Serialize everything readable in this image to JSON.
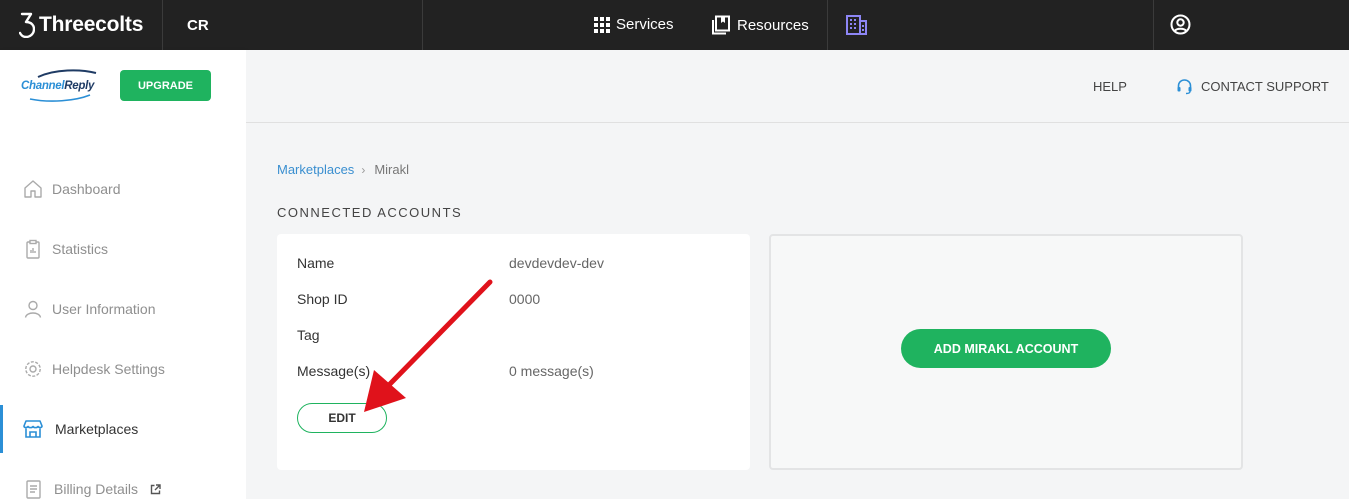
{
  "topbar": {
    "brand": "Threecolts",
    "account": "CR",
    "services_label": "Services",
    "resources_label": "Resources"
  },
  "sidebar": {
    "logo": {
      "part1": "Channel",
      "part2": "Reply"
    },
    "upgrade_label": "UPGRADE",
    "items": [
      {
        "label": "Dashboard",
        "icon": "home-icon"
      },
      {
        "label": "Statistics",
        "icon": "clipboard-icon"
      },
      {
        "label": "User Information",
        "icon": "user-icon"
      },
      {
        "label": "Helpdesk Settings",
        "icon": "gear-icon"
      },
      {
        "label": "Marketplaces",
        "icon": "store-icon",
        "active": true
      },
      {
        "label": "Billing Details",
        "icon": "document-icon",
        "external": true
      }
    ]
  },
  "header": {
    "help_label": "HELP",
    "support_label": "CONTACT SUPPORT"
  },
  "breadcrumb": {
    "parent": "Marketplaces",
    "current": "Mirakl"
  },
  "section_title": "CONNECTED ACCOUNTS",
  "account": {
    "fields": [
      {
        "label": "Name",
        "value": "devdevdev-dev"
      },
      {
        "label": "Shop ID",
        "value": "0000"
      },
      {
        "label": "Tag",
        "value": ""
      },
      {
        "label": "Message(s)",
        "value": "0 message(s)"
      }
    ],
    "edit_label": "EDIT"
  },
  "add_account_label": "ADD MIRAKL ACCOUNT",
  "colors": {
    "topbar": "#222222",
    "accent_green": "#1fb35f",
    "link_blue": "#3a8fd0",
    "annotation_red": "#e0121b",
    "building_icon": "#8d86f5"
  }
}
